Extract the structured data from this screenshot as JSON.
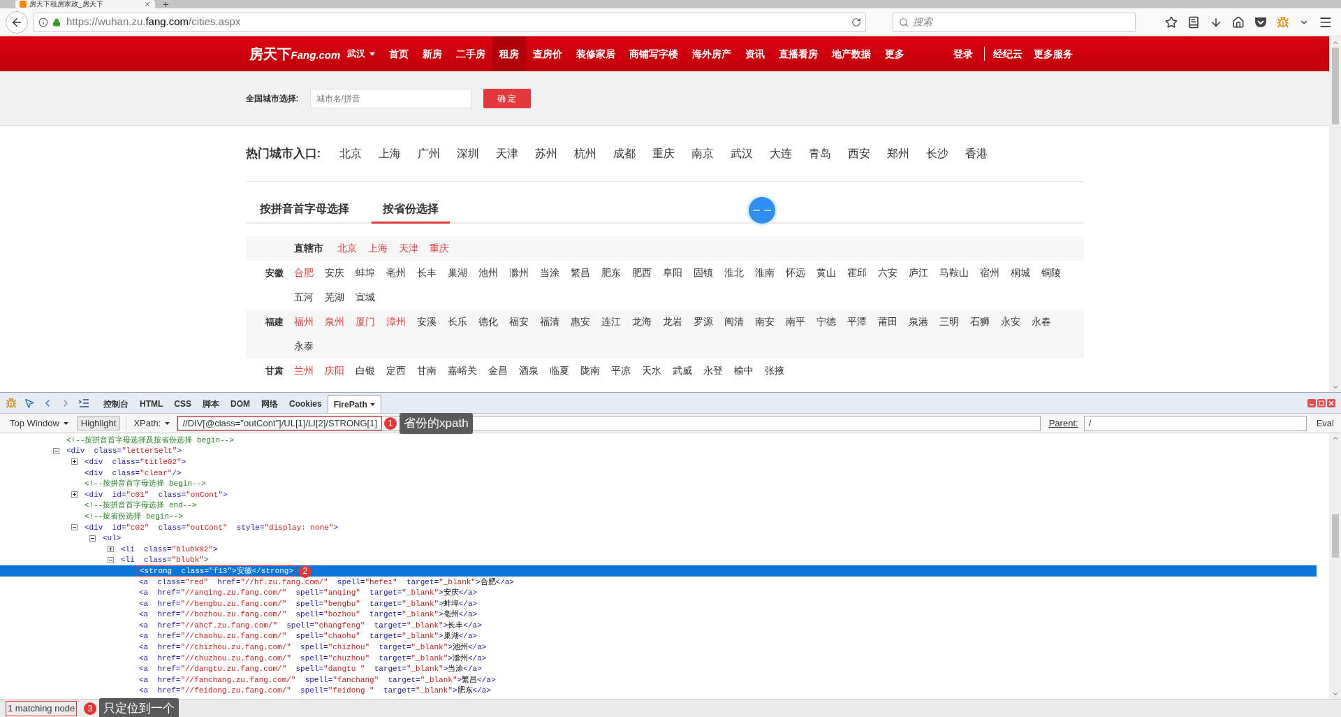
{
  "browser": {
    "tab_title": "房天下租房家政_房天下",
    "url_host": "https://wuhan.zu.",
    "url_domain": "fang.com",
    "url_path": "/cities.aspx",
    "search_placeholder": "搜索"
  },
  "nav": {
    "logo": "房天下",
    "logo_suffix": "Fang.com",
    "city": "武汉",
    "items": [
      {
        "label": "首页",
        "selected": false
      },
      {
        "label": "新房",
        "selected": false
      },
      {
        "label": "二手房",
        "selected": false
      },
      {
        "label": "租房",
        "selected": true
      },
      {
        "label": "查房价",
        "selected": false
      },
      {
        "label": "装修家居",
        "selected": false
      },
      {
        "label": "商铺写字楼",
        "selected": false
      },
      {
        "label": "海外房产",
        "selected": false
      },
      {
        "label": "资讯",
        "selected": false
      },
      {
        "label": "直播看房",
        "selected": false
      },
      {
        "label": "地产数据",
        "selected": false
      },
      {
        "label": "更多",
        "selected": false
      }
    ],
    "login": "登录",
    "right_items": [
      "经纪云",
      "更多服务"
    ]
  },
  "city_select": {
    "label": "全国城市选择:",
    "placeholder": "城市名/拼音",
    "button": "确 定"
  },
  "hot_cities": {
    "label": "热门城市入口:",
    "cities": [
      "北京",
      "上海",
      "广州",
      "深圳",
      "天津",
      "苏州",
      "杭州",
      "成都",
      "重庆",
      "南京",
      "武汉",
      "大连",
      "青岛",
      "西安",
      "郑州",
      "长沙",
      "香港"
    ]
  },
  "tabs": [
    {
      "label": "按拼音首字母选择",
      "selected": false
    },
    {
      "label": "按省份选择",
      "selected": true
    }
  ],
  "provinces": [
    {
      "kind": "inline",
      "name": "直辖市",
      "cities": [
        {
          "name": "北京",
          "hot": true
        },
        {
          "name": "上海",
          "hot": true
        },
        {
          "name": "天津",
          "hot": true
        },
        {
          "name": "重庆",
          "hot": true
        }
      ]
    },
    {
      "kind": "labeled",
      "name": "安徽",
      "cities": [
        {
          "name": "合肥",
          "hot": true
        },
        {
          "name": "安庆",
          "hot": false
        },
        {
          "name": "蚌埠",
          "hot": false
        },
        {
          "name": "亳州",
          "hot": false
        },
        {
          "name": "长丰",
          "hot": false
        },
        {
          "name": "巢湖",
          "hot": false
        },
        {
          "name": "池州",
          "hot": false
        },
        {
          "name": "滁州",
          "hot": false
        },
        {
          "name": "当涂",
          "hot": false
        },
        {
          "name": "繁昌",
          "hot": false
        },
        {
          "name": "肥东",
          "hot": false
        },
        {
          "name": "肥西",
          "hot": false
        },
        {
          "name": "阜阳",
          "hot": false
        },
        {
          "name": "固镇",
          "hot": false
        },
        {
          "name": "淮北",
          "hot": false
        },
        {
          "name": "淮南",
          "hot": false
        },
        {
          "name": "怀远",
          "hot": false
        },
        {
          "name": "黄山",
          "hot": false
        },
        {
          "name": "霍邱",
          "hot": false
        },
        {
          "name": "六安",
          "hot": false
        },
        {
          "name": "庐江",
          "hot": false
        },
        {
          "name": "马鞍山",
          "hot": false
        },
        {
          "name": "宿州",
          "hot": false
        },
        {
          "name": "桐城",
          "hot": false
        },
        {
          "name": "铜陵",
          "hot": false
        },
        {
          "name": "五河",
          "hot": false
        },
        {
          "name": "芜湖",
          "hot": false
        },
        {
          "name": "宣城",
          "hot": false
        }
      ]
    },
    {
      "kind": "labeled",
      "name": "福建",
      "cities": [
        {
          "name": "福州",
          "hot": true
        },
        {
          "name": "泉州",
          "hot": true
        },
        {
          "name": "厦门",
          "hot": true
        },
        {
          "name": "漳州",
          "hot": true
        },
        {
          "name": "安溪",
          "hot": false
        },
        {
          "name": "长乐",
          "hot": false
        },
        {
          "name": "德化",
          "hot": false
        },
        {
          "name": "福安",
          "hot": false
        },
        {
          "name": "福清",
          "hot": false
        },
        {
          "name": "惠安",
          "hot": false
        },
        {
          "name": "连江",
          "hot": false
        },
        {
          "name": "龙海",
          "hot": false
        },
        {
          "name": "龙岩",
          "hot": false
        },
        {
          "name": "罗源",
          "hot": false
        },
        {
          "name": "闽清",
          "hot": false
        },
        {
          "name": "南安",
          "hot": false
        },
        {
          "name": "南平",
          "hot": false
        },
        {
          "name": "宁德",
          "hot": false
        },
        {
          "name": "平潭",
          "hot": false
        },
        {
          "name": "莆田",
          "hot": false
        },
        {
          "name": "泉港",
          "hot": false
        },
        {
          "name": "三明",
          "hot": false
        },
        {
          "name": "石狮",
          "hot": false
        },
        {
          "name": "永安",
          "hot": false
        },
        {
          "name": "永春",
          "hot": false
        },
        {
          "name": "永泰",
          "hot": false
        }
      ]
    },
    {
      "kind": "labeled",
      "name": "甘肃",
      "cities": [
        {
          "name": "兰州",
          "hot": true
        },
        {
          "name": "庆阳",
          "hot": true
        },
        {
          "name": "白银",
          "hot": false
        },
        {
          "name": "定西",
          "hot": false
        },
        {
          "name": "甘南",
          "hot": false
        },
        {
          "name": "嘉峪关",
          "hot": false
        },
        {
          "name": "金昌",
          "hot": false
        },
        {
          "name": "酒泉",
          "hot": false
        },
        {
          "name": "临夏",
          "hot": false
        },
        {
          "name": "陇南",
          "hot": false
        },
        {
          "name": "平凉",
          "hot": false
        },
        {
          "name": "天水",
          "hot": false
        },
        {
          "name": "武威",
          "hot": false
        },
        {
          "name": "永登",
          "hot": false
        },
        {
          "name": "榆中",
          "hot": false
        },
        {
          "name": "张掖",
          "hot": false
        }
      ]
    }
  ],
  "devtools": {
    "tabs": [
      {
        "label": "控制台",
        "selected": false
      },
      {
        "label": "HTML",
        "selected": false
      },
      {
        "label": "CSS",
        "selected": false
      },
      {
        "label": "脚本",
        "selected": false
      },
      {
        "label": "DOM",
        "selected": false
      },
      {
        "label": "网络",
        "selected": false
      },
      {
        "label": "Cookies",
        "selected": false
      },
      {
        "label": "FirePath",
        "selected": true
      }
    ],
    "window_select": "Top Window",
    "highlight": "Highlight",
    "xpath_label": "XPath:",
    "xpath": "//DIV[@class=\"outCont\"]/UL[1]/LI[2]/STRONG[1]",
    "xpath_marker": {
      "number": "1",
      "note": "省份的xpath"
    },
    "parent_label": "Parent:",
    "parent": "/",
    "eval": "Eval",
    "tree": [
      {
        "selected": false,
        "tokens": [
          {
            "kind": "comment",
            "text": "<!--按拼音首字母选择及按省份选择 begin-->"
          }
        ]
      },
      {
        "expanded": true,
        "selected": false,
        "tokens": [
          {
            "kind": "tag",
            "text": "<div  class="
          },
          {
            "kind": "value",
            "text": "\"letterSelt\""
          },
          {
            "kind": "tag",
            "text": ">"
          }
        ],
        "children": [
          {
            "expanded": false,
            "selected": false,
            "tokens": [
              {
                "kind": "tag",
                "text": "<div  class="
              },
              {
                "kind": "value",
                "text": "\"title02\""
              },
              {
                "kind": "tag",
                "text": ">"
              }
            ]
          },
          {
            "selected": false,
            "tokens": [
              {
                "kind": "tag",
                "text": "<div  class="
              },
              {
                "kind": "value",
                "text": "\"clear\""
              },
              {
                "kind": "tag",
                "text": "/>"
              }
            ]
          },
          {
            "selected": false,
            "tokens": [
              {
                "kind": "comment",
                "text": "<!--按拼音首字母选择 begin-->"
              }
            ]
          },
          {
            "expanded": false,
            "selected": false,
            "tokens": [
              {
                "kind": "tag",
                "text": "<div  id="
              },
              {
                "kind": "value",
                "text": "\"c01\""
              },
              {
                "kind": "tag",
                "text": "  class="
              },
              {
                "kind": "value",
                "text": "\"onCont\""
              },
              {
                "kind": "tag",
                "text": ">"
              }
            ]
          },
          {
            "selected": false,
            "tokens": [
              {
                "kind": "comment",
                "text": "<!--按拼音首字母选择 end-->"
              }
            ]
          },
          {
            "selected": false,
            "tokens": [
              {
                "kind": "comment",
                "text": "<!--按省份选择 begin-->"
              }
            ]
          },
          {
            "expanded": true,
            "selected": false,
            "tokens": [
              {
                "kind": "tag",
                "text": "<div  id="
              },
              {
                "kind": "value",
                "text": "\"c02\""
              },
              {
                "kind": "tag",
                "text": "  class="
              },
              {
                "kind": "value",
                "text": "\"outCont\""
              },
              {
                "kind": "tag",
                "text": "  style="
              },
              {
                "kind": "value",
                "text": "\"display: none\""
              },
              {
                "kind": "tag",
                "text": ">"
              }
            ],
            "children": [
              {
                "expanded": true,
                "selected": false,
                "tokens": [
                  {
                    "kind": "tag",
                    "text": "<ul>"
                  }
                ],
                "children": [
                  {
                    "expanded": false,
                    "selected": false,
                    "tokens": [
                      {
                        "kind": "tag",
                        "text": "<li  class="
                      },
                      {
                        "kind": "value",
                        "text": "\"blubk02\""
                      },
                      {
                        "kind": "tag",
                        "text": ">"
                      }
                    ]
                  },
                  {
                    "expanded": true,
                    "selected": false,
                    "tokens": [
                      {
                        "kind": "tag",
                        "text": "<li  class="
                      },
                      {
                        "kind": "value",
                        "text": "\"blubk\""
                      },
                      {
                        "kind": "tag",
                        "text": ">"
                      }
                    ],
                    "children": [
                      {
                        "selected": true,
                        "marker": "2",
                        "tokens": [
                          {
                            "kind": "tag",
                            "text": "<strong  class="
                          },
                          {
                            "kind": "value",
                            "text": "\"f13\""
                          },
                          {
                            "kind": "tag",
                            "text": ">"
                          },
                          {
                            "kind": "text",
                            "text": "安徽"
                          },
                          {
                            "kind": "tag",
                            "text": "</strong>"
                          }
                        ]
                      },
                      {
                        "selected": false,
                        "tokens": [
                          {
                            "kind": "tag",
                            "text": "<a  class="
                          },
                          {
                            "kind": "value",
                            "text": "\"red\""
                          },
                          {
                            "kind": "tag",
                            "text": "  href="
                          },
                          {
                            "kind": "value",
                            "text": "\"//hf.zu.fang.com/\""
                          },
                          {
                            "kind": "tag",
                            "text": "  spell="
                          },
                          {
                            "kind": "value",
                            "text": "\"hefei\""
                          },
                          {
                            "kind": "tag",
                            "text": "  target="
                          },
                          {
                            "kind": "value",
                            "text": "\"_blank\""
                          },
                          {
                            "kind": "tag",
                            "text": ">"
                          },
                          {
                            "kind": "text",
                            "text": "合肥"
                          },
                          {
                            "kind": "tag",
                            "text": "</a>"
                          }
                        ]
                      },
                      {
                        "selected": false,
                        "tokens": [
                          {
                            "kind": "tag",
                            "text": "<a  href="
                          },
                          {
                            "kind": "value",
                            "text": "\"//anqing.zu.fang.com/\""
                          },
                          {
                            "kind": "tag",
                            "text": "  spell="
                          },
                          {
                            "kind": "value",
                            "text": "\"anqing\""
                          },
                          {
                            "kind": "tag",
                            "text": "  target="
                          },
                          {
                            "kind": "value",
                            "text": "\"_blank\""
                          },
                          {
                            "kind": "tag",
                            "text": ">"
                          },
                          {
                            "kind": "text",
                            "text": "安庆"
                          },
                          {
                            "kind": "tag",
                            "text": "</a>"
                          }
                        ]
                      },
                      {
                        "selected": false,
                        "tokens": [
                          {
                            "kind": "tag",
                            "text": "<a  href="
                          },
                          {
                            "kind": "value",
                            "text": "\"//bengbu.zu.fang.com/\""
                          },
                          {
                            "kind": "tag",
                            "text": "  spell="
                          },
                          {
                            "kind": "value",
                            "text": "\"bengbu\""
                          },
                          {
                            "kind": "tag",
                            "text": "  target="
                          },
                          {
                            "kind": "value",
                            "text": "\"_blank\""
                          },
                          {
                            "kind": "tag",
                            "text": ">"
                          },
                          {
                            "kind": "text",
                            "text": "蚌埠"
                          },
                          {
                            "kind": "tag",
                            "text": "</a>"
                          }
                        ]
                      },
                      {
                        "selected": false,
                        "tokens": [
                          {
                            "kind": "tag",
                            "text": "<a  href="
                          },
                          {
                            "kind": "value",
                            "text": "\"//bozhou.zu.fang.com/\""
                          },
                          {
                            "kind": "tag",
                            "text": "  spell="
                          },
                          {
                            "kind": "value",
                            "text": "\"bozhou\""
                          },
                          {
                            "kind": "tag",
                            "text": "  target="
                          },
                          {
                            "kind": "value",
                            "text": "\"_blank\""
                          },
                          {
                            "kind": "tag",
                            "text": ">"
                          },
                          {
                            "kind": "text",
                            "text": "亳州"
                          },
                          {
                            "kind": "tag",
                            "text": "</a>"
                          }
                        ]
                      },
                      {
                        "selected": false,
                        "tokens": [
                          {
                            "kind": "tag",
                            "text": "<a  href="
                          },
                          {
                            "kind": "value",
                            "text": "\"//ahcf.zu.fang.com/\""
                          },
                          {
                            "kind": "tag",
                            "text": "  spell="
                          },
                          {
                            "kind": "value",
                            "text": "\"changfeng\""
                          },
                          {
                            "kind": "tag",
                            "text": "  target="
                          },
                          {
                            "kind": "value",
                            "text": "\"_blank\""
                          },
                          {
                            "kind": "tag",
                            "text": ">"
                          },
                          {
                            "kind": "text",
                            "text": "长丰"
                          },
                          {
                            "kind": "tag",
                            "text": "</a>"
                          }
                        ]
                      },
                      {
                        "selected": false,
                        "tokens": [
                          {
                            "kind": "tag",
                            "text": "<a  href="
                          },
                          {
                            "kind": "value",
                            "text": "\"//chaohu.zu.fang.com/\""
                          },
                          {
                            "kind": "tag",
                            "text": "  spell="
                          },
                          {
                            "kind": "value",
                            "text": "\"chaohu\""
                          },
                          {
                            "kind": "tag",
                            "text": "  target="
                          },
                          {
                            "kind": "value",
                            "text": "\"_blank\""
                          },
                          {
                            "kind": "tag",
                            "text": ">"
                          },
                          {
                            "kind": "text",
                            "text": "巢湖"
                          },
                          {
                            "kind": "tag",
                            "text": "</a>"
                          }
                        ]
                      },
                      {
                        "selected": false,
                        "tokens": [
                          {
                            "kind": "tag",
                            "text": "<a  href="
                          },
                          {
                            "kind": "value",
                            "text": "\"//chizhou.zu.fang.com/\""
                          },
                          {
                            "kind": "tag",
                            "text": "  spell="
                          },
                          {
                            "kind": "value",
                            "text": "\"chizhou\""
                          },
                          {
                            "kind": "tag",
                            "text": "  target="
                          },
                          {
                            "kind": "value",
                            "text": "\"_blank\""
                          },
                          {
                            "kind": "tag",
                            "text": ">"
                          },
                          {
                            "kind": "text",
                            "text": "池州"
                          },
                          {
                            "kind": "tag",
                            "text": "</a>"
                          }
                        ]
                      },
                      {
                        "selected": false,
                        "tokens": [
                          {
                            "kind": "tag",
                            "text": "<a  href="
                          },
                          {
                            "kind": "value",
                            "text": "\"//chuzhou.zu.fang.com/\""
                          },
                          {
                            "kind": "tag",
                            "text": "  spell="
                          },
                          {
                            "kind": "value",
                            "text": "\"chuzhou\""
                          },
                          {
                            "kind": "tag",
                            "text": "  target="
                          },
                          {
                            "kind": "value",
                            "text": "\"_blank\""
                          },
                          {
                            "kind": "tag",
                            "text": ">"
                          },
                          {
                            "kind": "text",
                            "text": "滁州"
                          },
                          {
                            "kind": "tag",
                            "text": "</a>"
                          }
                        ]
                      },
                      {
                        "selected": false,
                        "tokens": [
                          {
                            "kind": "tag",
                            "text": "<a  href="
                          },
                          {
                            "kind": "value",
                            "text": "\"//dangtu.zu.fang.com/\""
                          },
                          {
                            "kind": "tag",
                            "text": "  spell="
                          },
                          {
                            "kind": "value",
                            "text": "\"dangtu \""
                          },
                          {
                            "kind": "tag",
                            "text": "  target="
                          },
                          {
                            "kind": "value",
                            "text": "\"_blank\""
                          },
                          {
                            "kind": "tag",
                            "text": ">"
                          },
                          {
                            "kind": "text",
                            "text": "当涂"
                          },
                          {
                            "kind": "tag",
                            "text": "</a>"
                          }
                        ]
                      },
                      {
                        "selected": false,
                        "tokens": [
                          {
                            "kind": "tag",
                            "text": "<a  href="
                          },
                          {
                            "kind": "value",
                            "text": "\"//fanchang.zu.fang.com/\""
                          },
                          {
                            "kind": "tag",
                            "text": "  spell="
                          },
                          {
                            "kind": "value",
                            "text": "\"fanchang\""
                          },
                          {
                            "kind": "tag",
                            "text": "  target="
                          },
                          {
                            "kind": "value",
                            "text": "\"_blank\""
                          },
                          {
                            "kind": "tag",
                            "text": ">"
                          },
                          {
                            "kind": "text",
                            "text": "繁昌"
                          },
                          {
                            "kind": "tag",
                            "text": "</a>"
                          }
                        ]
                      },
                      {
                        "selected": false,
                        "tokens": [
                          {
                            "kind": "tag",
                            "text": "<a  href="
                          },
                          {
                            "kind": "value",
                            "text": "\"//feidong.zu.fang.com/\""
                          },
                          {
                            "kind": "tag",
                            "text": "  spell="
                          },
                          {
                            "kind": "value",
                            "text": "\"feidong \""
                          },
                          {
                            "kind": "tag",
                            "text": "  target="
                          },
                          {
                            "kind": "value",
                            "text": "\"_blank\""
                          },
                          {
                            "kind": "tag",
                            "text": ">"
                          },
                          {
                            "kind": "text",
                            "text": "肥东"
                          },
                          {
                            "kind": "tag",
                            "text": "</a>"
                          }
                        ]
                      }
                    ]
                  }
                ]
              }
            ]
          }
        ]
      }
    ],
    "status": {
      "text": "1 matching node",
      "marker": {
        "number": "3",
        "note": "只定位到一个"
      }
    }
  }
}
